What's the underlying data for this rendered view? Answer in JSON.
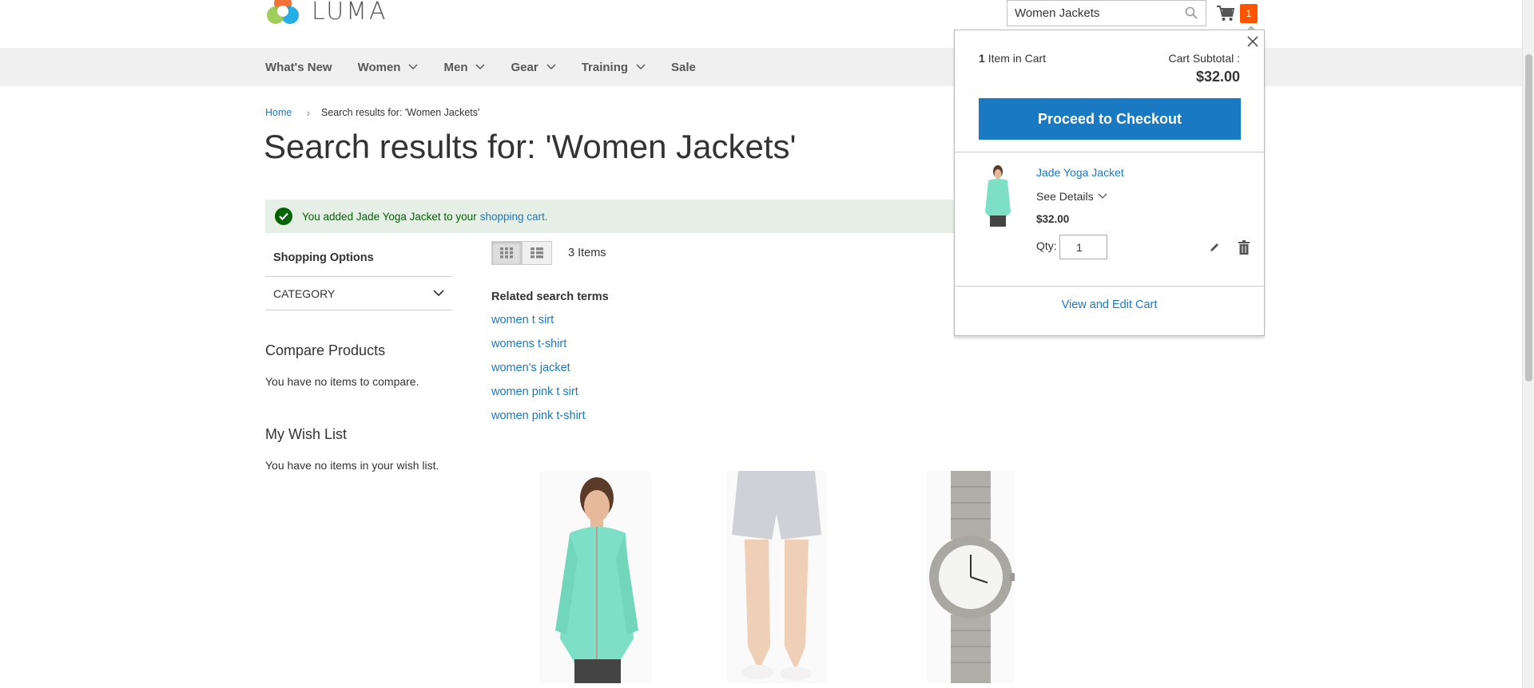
{
  "header": {
    "logo_text": "LUMA",
    "search_value": "Women Jackets",
    "cart_count": "1"
  },
  "nav": {
    "items": [
      {
        "label": "What's New",
        "has_dropdown": false
      },
      {
        "label": "Women",
        "has_dropdown": true
      },
      {
        "label": "Men",
        "has_dropdown": true
      },
      {
        "label": "Gear",
        "has_dropdown": true
      },
      {
        "label": "Training",
        "has_dropdown": true
      },
      {
        "label": "Sale",
        "has_dropdown": false
      }
    ]
  },
  "breadcrumb": {
    "home": "Home",
    "current": "Search results for: 'Women Jackets'"
  },
  "page_title": "Search results for: 'Women Jackets'",
  "message": {
    "text": "You added Jade Yoga Jacket to your",
    "link": "shopping cart."
  },
  "sidebar": {
    "shopping_options": "Shopping Options",
    "category": "CATEGORY",
    "compare_title": "Compare Products",
    "compare_text": "You have no items to compare.",
    "wishlist_title": "My Wish List",
    "wishlist_text": "You have no items in your wish list."
  },
  "toolbar": {
    "items_count": "3 Items"
  },
  "related": {
    "title": "Related search terms",
    "terms": [
      "women t sirt",
      "womens t-shirt",
      "women's jacket",
      "women pink t sirt",
      "women pink t-shirt"
    ]
  },
  "products": [
    {
      "image": "teal-zip-jacket"
    },
    {
      "image": "gray-shorts"
    },
    {
      "image": "silver-watch"
    }
  ],
  "minicart": {
    "count_num": "1",
    "count_label": "Item in Cart",
    "subtotal_label": "Cart Subtotal :",
    "subtotal": "$32.00",
    "checkout": "Proceed to Checkout",
    "item_name": "Jade Yoga Jacket",
    "see_details": "See Details",
    "item_price": "$32.00",
    "qty_label": "Qty:",
    "qty_value": "1",
    "view_cart": "View and Edit Cart"
  },
  "colors": {
    "accent": "#1979c3",
    "cart_badge": "#ff5501",
    "success_bg": "#e5efe5",
    "success_text": "#006400",
    "nav_bg": "#f0f0f0"
  }
}
